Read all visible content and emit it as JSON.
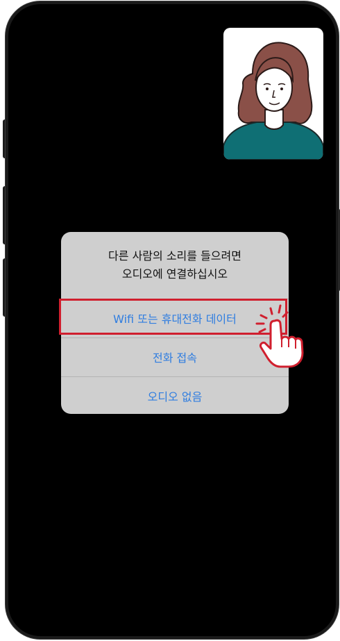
{
  "dialog": {
    "title_line1": "다른 사람의 소리를 들으려면",
    "title_line2": "오디오에 연결하십시오",
    "options": [
      {
        "label": "Wifi 또는 휴대전화 데이터"
      },
      {
        "label": "전화 접속"
      },
      {
        "label": "오디오 없음"
      }
    ]
  },
  "colors": {
    "option_text": "#2f7de0",
    "dialog_bg": "#cfcfcf",
    "highlight": "#d01f2e",
    "screen": "#000000"
  },
  "icons": {
    "participant": "person-avatar-icon",
    "pointer": "hand-pointer-icon"
  }
}
